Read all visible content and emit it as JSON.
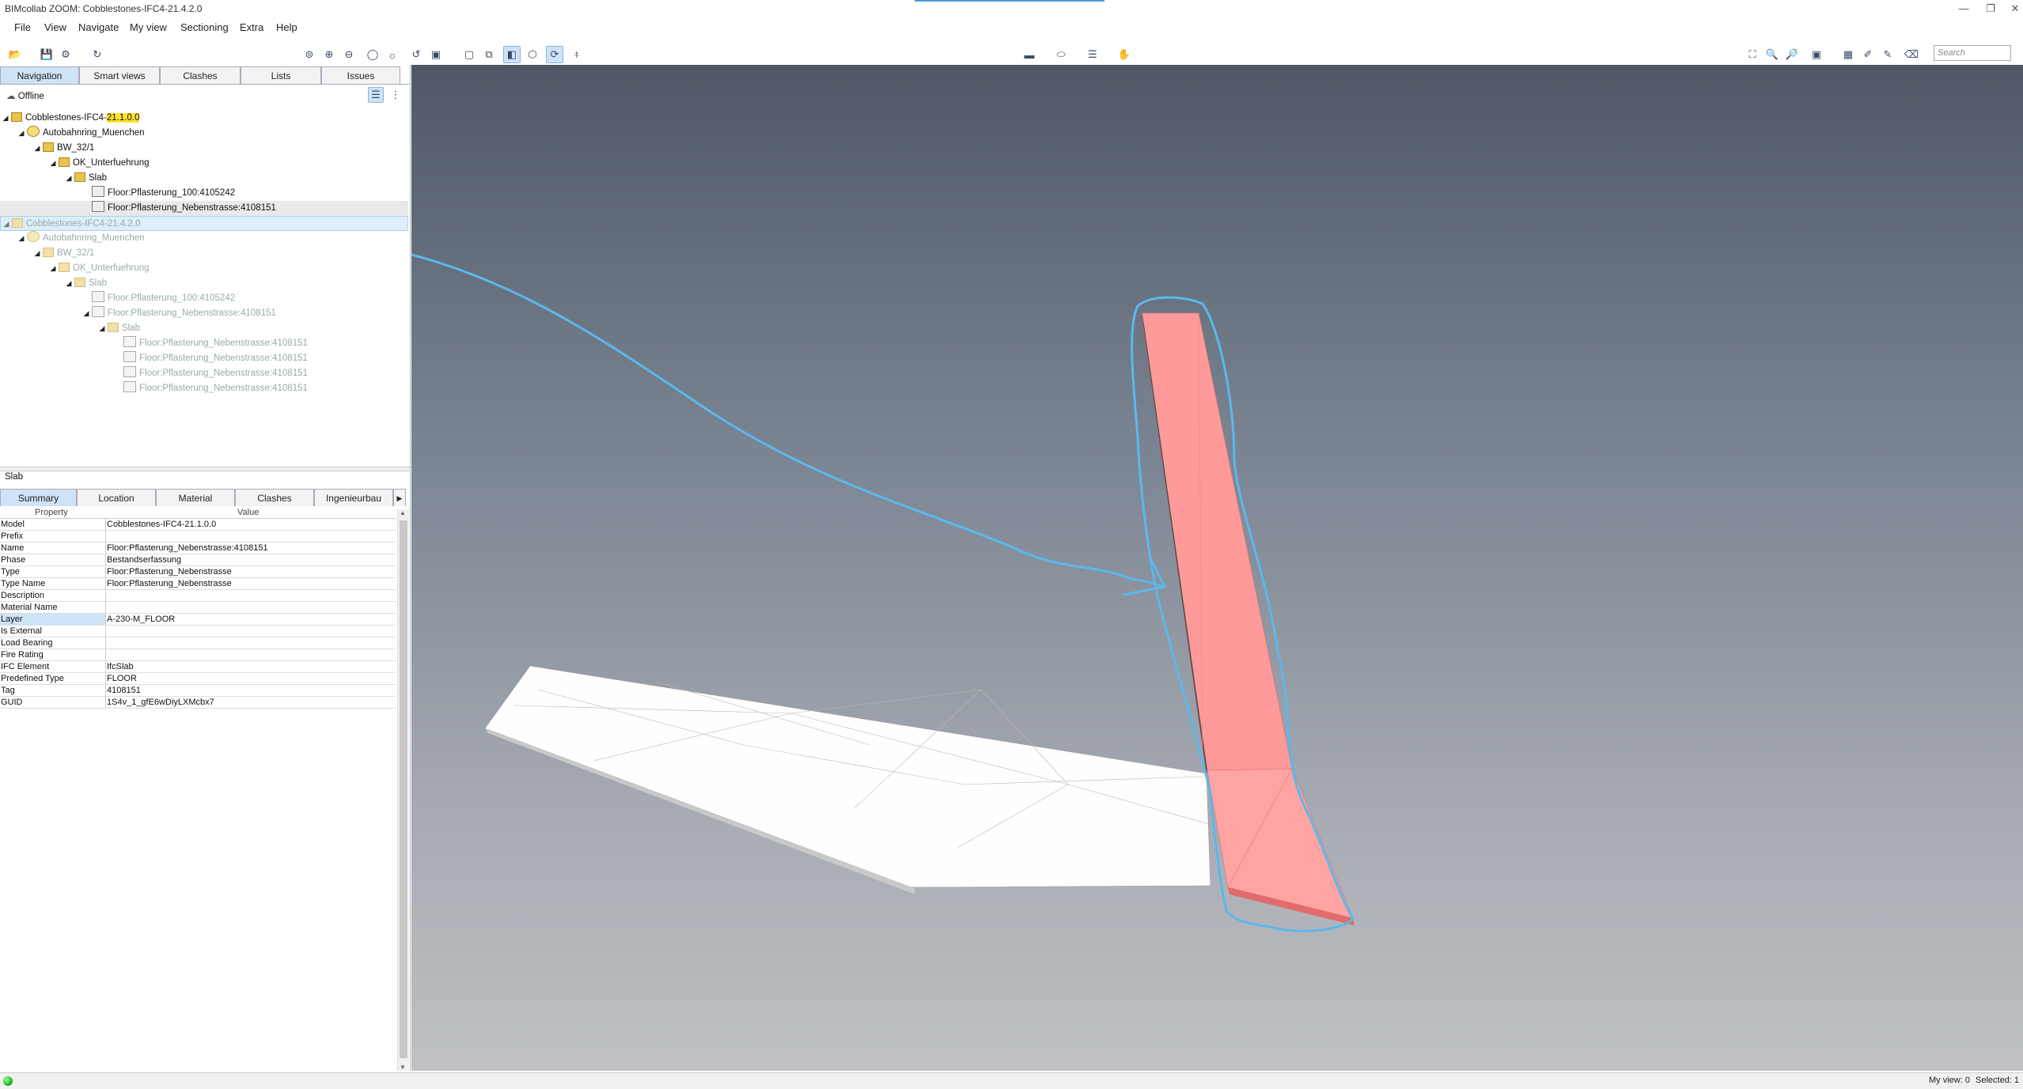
{
  "window": {
    "title": "BIMcollab ZOOM: Cobblestones-IFC4-21.4.2.0"
  },
  "menu": [
    "File",
    "View",
    "Navigate",
    "My view",
    "Sectioning",
    "Extra",
    "Help"
  ],
  "search": {
    "placeholder": "Search"
  },
  "left_tabs": [
    "Navigation",
    "Smart views",
    "Clashes",
    "Lists",
    "Issues"
  ],
  "offline_label": "Offline",
  "tree": [
    {
      "label": "Cobblestones-IFC4-21.1.0.0",
      "label_plain": "Cobblestones-IFC4-",
      "label_highlight": "21.1.0.0"
    },
    {
      "label": "Autobahnring_Muenchen"
    },
    {
      "label": "BW_32/1"
    },
    {
      "label": "OK_Unterfuehrung"
    },
    {
      "label": "Slab"
    },
    {
      "label": "Floor:Pflasterung_100:4105242"
    },
    {
      "label": "Floor:Pflasterung_Nebenstrasse:4108151"
    },
    {
      "label": "Cobblestones-IFC4-21.4.2.0"
    },
    {
      "label": "Autobahnring_Muenchen"
    },
    {
      "label": "BW_32/1"
    },
    {
      "label": "OK_Unterfuehrung"
    },
    {
      "label": "Slab"
    },
    {
      "label": "Floor:Pflasterung_100:4105242"
    },
    {
      "label": "Floor:Pflasterung_Nebenstrasse:4108151"
    },
    {
      "label": "Slab"
    },
    {
      "label": "Floor:Pflasterung_Nebenstrasse:4108151"
    },
    {
      "label": "Floor:Pflasterung_Nebenstrasse:4108151"
    },
    {
      "label": "Floor:Pflasterung_Nebenstrasse:4108151"
    },
    {
      "label": "Floor:Pflasterung_Nebenstrasse:4108151"
    }
  ],
  "selection_title": "Slab",
  "prop_tabs": [
    "Summary",
    "Location",
    "Material",
    "Clashes",
    "Ingenieurbau"
  ],
  "prop_headers": {
    "property": "Property",
    "value": "Value"
  },
  "properties": [
    {
      "name": "Model",
      "value": "Cobblestones-IFC4-21.1.0.0"
    },
    {
      "name": "Prefix",
      "value": ""
    },
    {
      "name": "Name",
      "value": "Floor:Pflasterung_Nebenstrasse:4108151"
    },
    {
      "name": "Phase",
      "value": "Bestandserfassung"
    },
    {
      "name": "Type",
      "value": "Floor:Pflasterung_Nebenstrasse"
    },
    {
      "name": "Type Name",
      "value": "Floor:Pflasterung_Nebenstrasse"
    },
    {
      "name": "Description",
      "value": ""
    },
    {
      "name": "Material Name",
      "value": ""
    },
    {
      "name": "Layer",
      "value": "A-230-M_FLOOR"
    },
    {
      "name": "Is External",
      "value": ""
    },
    {
      "name": "Load Bearing",
      "value": ""
    },
    {
      "name": "Fire Rating",
      "value": ""
    },
    {
      "name": "IFC Element",
      "value": "IfcSlab"
    },
    {
      "name": "Predefined Type",
      "value": "FLOOR"
    },
    {
      "name": "Tag",
      "value": "4108151"
    },
    {
      "name": "GUID",
      "value": "1S4v_1_gfE6wDiyLXMcbx7"
    }
  ],
  "status": {
    "myview": "My view: 0",
    "selected": "Selected: 1"
  },
  "colors": {
    "accent": "#cfe3f7",
    "annotation": "#5bb8ec",
    "selected_object": "#ff9c9c"
  },
  "icons": [
    "open-icon",
    "save-icon",
    "settings-icon",
    "sync-icon",
    "zoom-in-icon",
    "zoom-out-icon",
    "section-box-icon",
    "search-icon"
  ]
}
